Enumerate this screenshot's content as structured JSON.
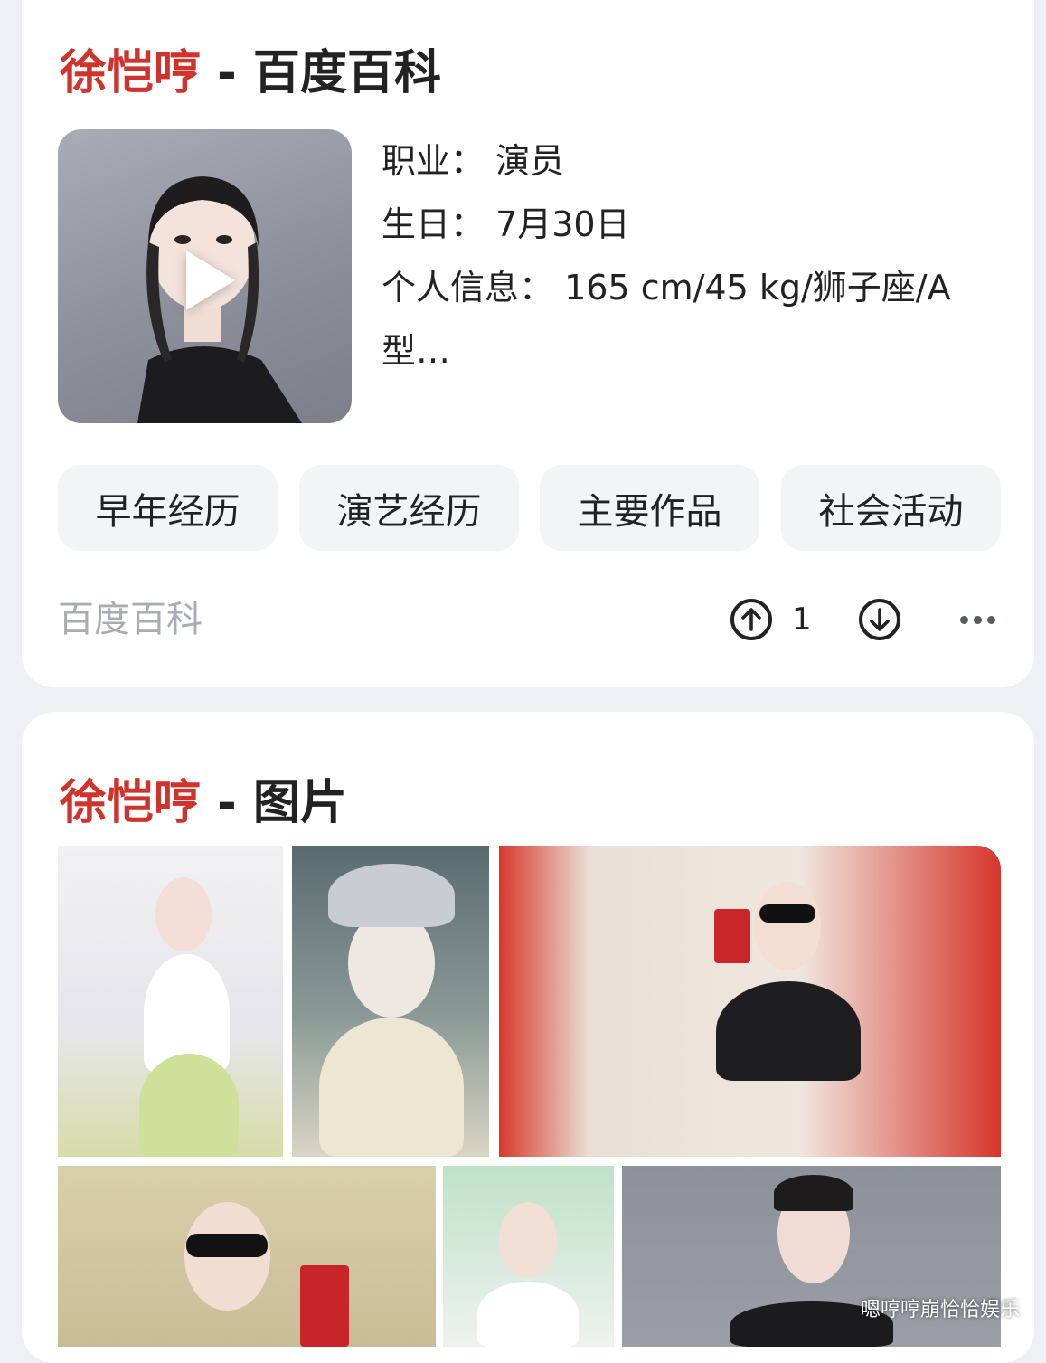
{
  "baike": {
    "title_name": "徐恺哼",
    "title_sep": " - ",
    "title_rest": "百度百科",
    "info": {
      "profession": "职业： 演员",
      "birthday": "生日： 7月30日",
      "personal": "个人信息： 165 cm/45 kg/狮子座/A型…"
    },
    "chips": [
      "早年经历",
      "演艺经历",
      "主要作品",
      "社会活动"
    ],
    "source": "百度百科",
    "upvote_count": "1"
  },
  "images": {
    "title_name": "徐恺哼",
    "title_sep": " - ",
    "title_rest": "图片"
  },
  "watermark": "嗯哼哼崩恰恰娱乐",
  "colors": {
    "accent": "#d0332c",
    "text": "#222222",
    "muted": "#a9acb2",
    "chip_bg": "#f3f4f6"
  }
}
